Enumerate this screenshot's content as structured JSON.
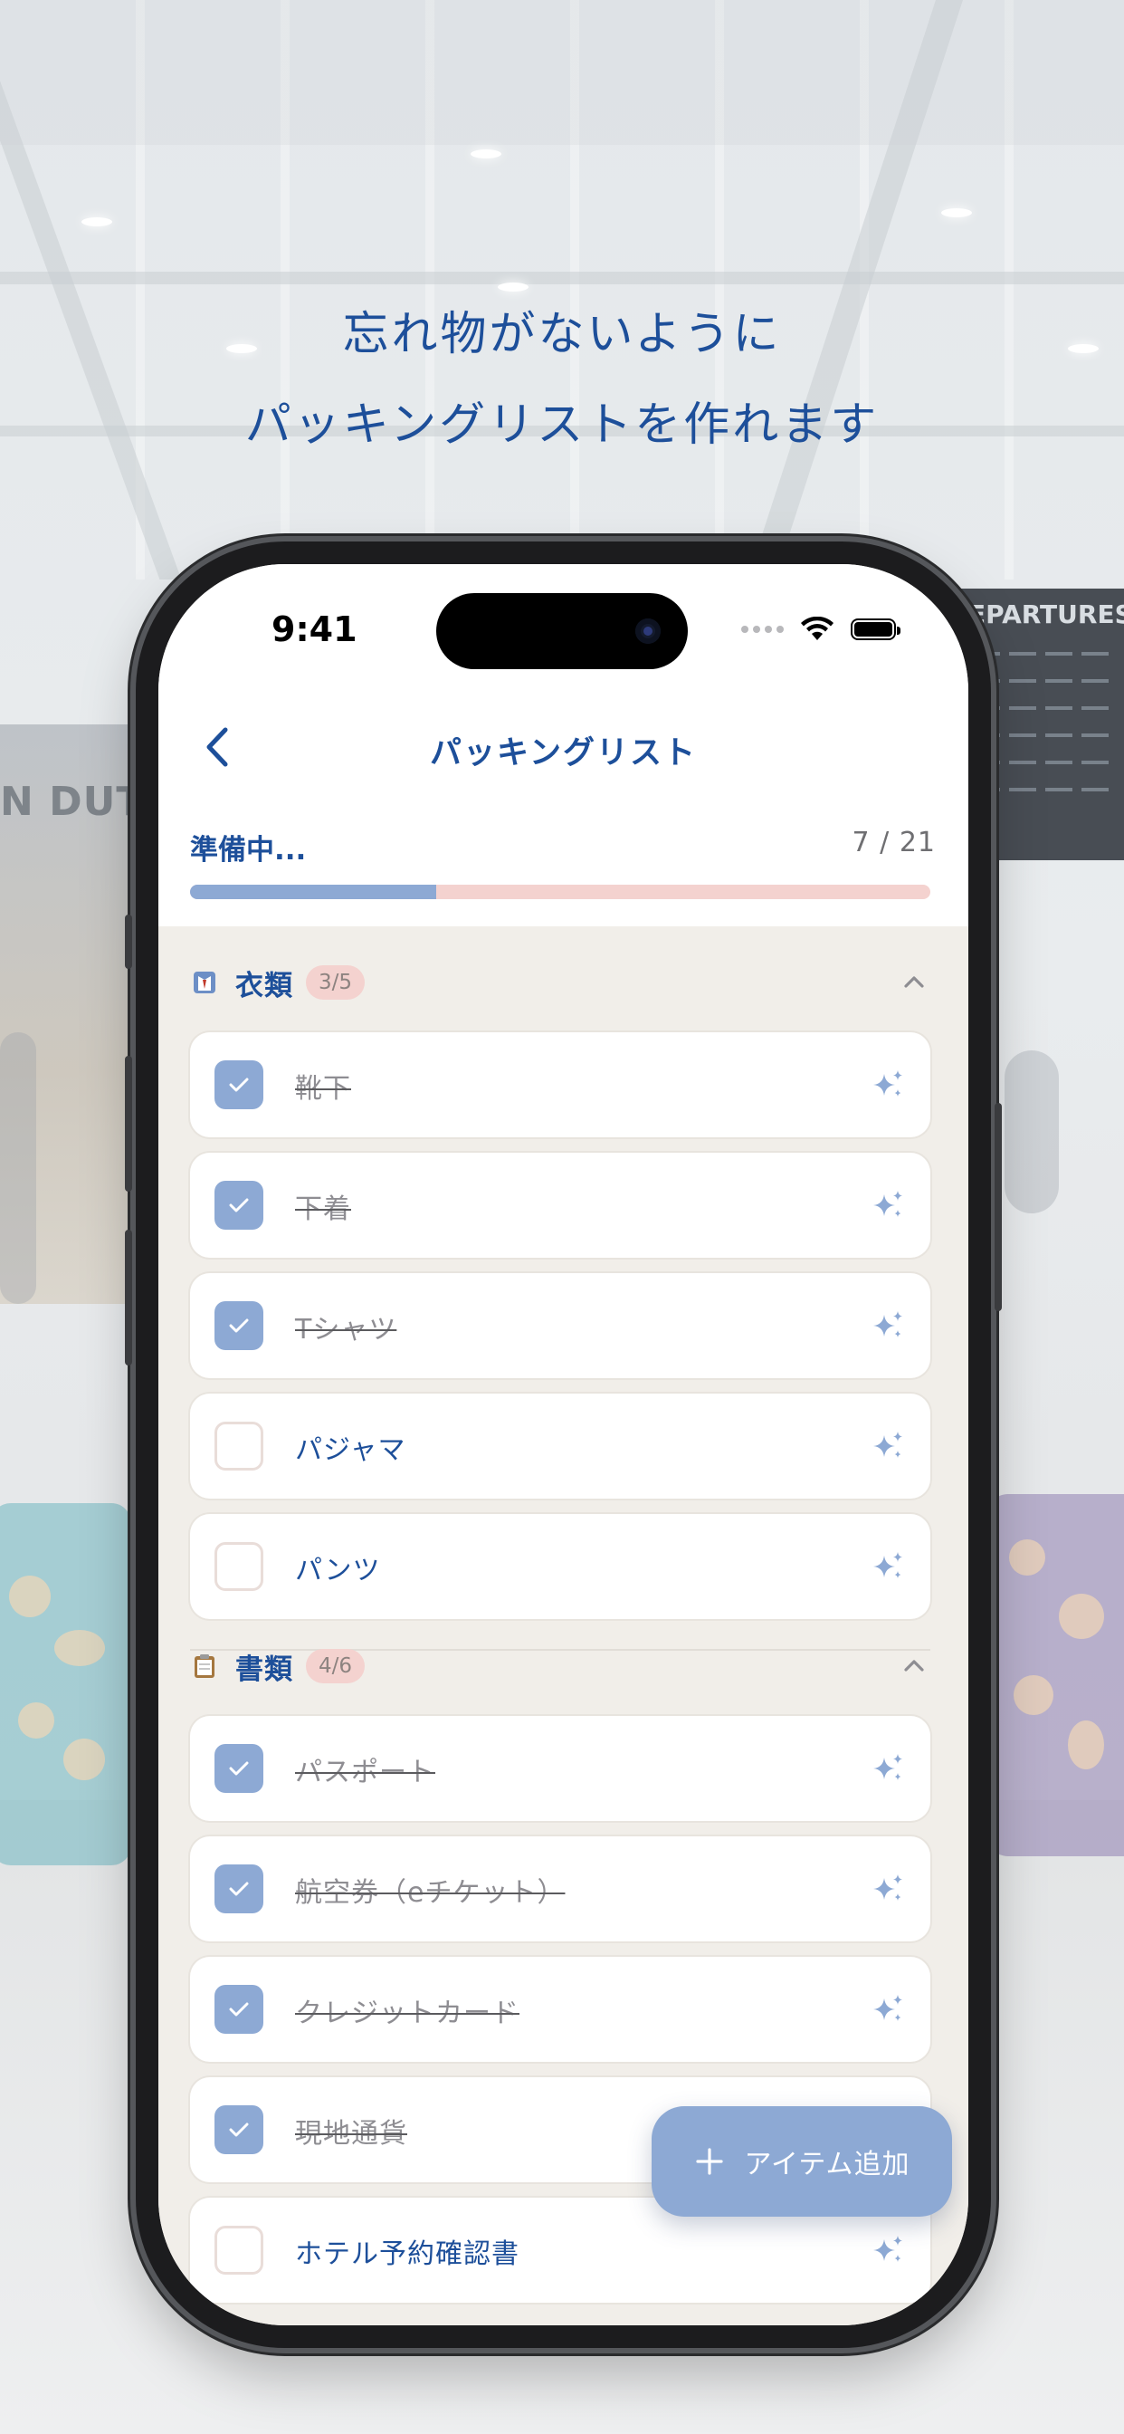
{
  "headline": {
    "line1": "忘れ物がないように",
    "line2": "パッキングリストを作れます"
  },
  "background_signs": {
    "duty_free": "N DUTY F",
    "departures": "EPARTURES"
  },
  "status_bar": {
    "time": "9:41"
  },
  "header": {
    "title": "パッキングリスト",
    "back_icon": "chevron-left-icon"
  },
  "progress": {
    "label": "準備中...",
    "count": "7 / 21",
    "fraction": 0.333,
    "fill_color": "#8da9d4",
    "track_color": "#f4d2cf"
  },
  "sections": [
    {
      "emoji_icon": "clothes-icon",
      "title": "衣類",
      "badge": "3/5",
      "chevron": "chevron-up-icon",
      "items": [
        {
          "label": "靴下",
          "checked": true
        },
        {
          "label": "下着",
          "checked": true
        },
        {
          "label": "Tシャツ",
          "checked": true
        },
        {
          "label": "パジャマ",
          "checked": false
        },
        {
          "label": "パンツ",
          "checked": false
        }
      ]
    },
    {
      "emoji_icon": "clipboard-icon",
      "title": "書類",
      "badge": "4/6",
      "chevron": "chevron-up-icon",
      "items": [
        {
          "label": "パスポート",
          "checked": true
        },
        {
          "label": "航空券（eチケット）",
          "checked": true
        },
        {
          "label": "クレジットカード",
          "checked": true
        },
        {
          "label": "現地通貨",
          "checked": true
        },
        {
          "label": "ホテル予約確認書",
          "checked": false
        }
      ]
    }
  ],
  "fab": {
    "label": "アイテム追加",
    "icon": "plus-icon"
  },
  "colors": {
    "brand": "#1d4f9a",
    "accent": "#8da9d4",
    "badge_bg": "#f4d2cf",
    "list_bg": "#f1eee9"
  }
}
